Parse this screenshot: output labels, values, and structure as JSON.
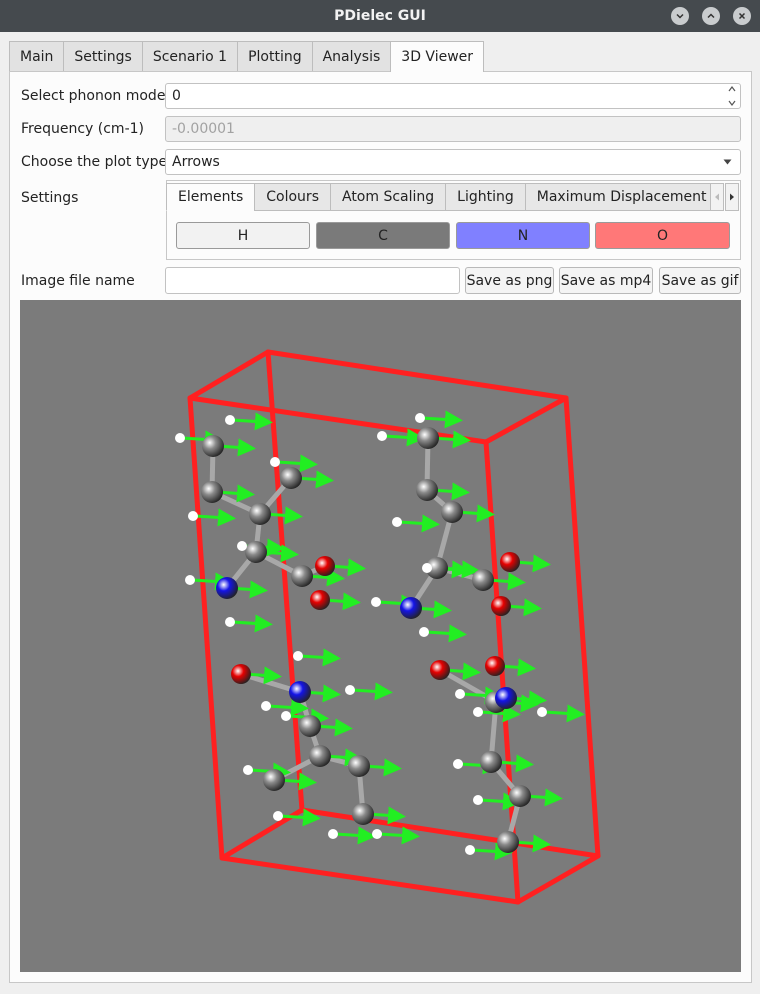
{
  "window": {
    "title": "PDielec GUI"
  },
  "main_tabs": [
    "Main",
    "Settings",
    "Scenario 1",
    "Plotting",
    "Analysis",
    "3D Viewer"
  ],
  "form": {
    "phonon_mode_label": "Select phonon mode",
    "phonon_mode_value": "0",
    "frequency_label": "Frequency (cm-1)",
    "frequency_value": "-0.00001",
    "plot_type_label": "Choose the plot type",
    "plot_type_value": "Arrows",
    "settings_label": "Settings",
    "image_file_label": "Image file name",
    "image_file_value": ""
  },
  "settings_tabs": [
    "Elements",
    "Colours",
    "Atom Scaling",
    "Lighting",
    "Maximum Displacement"
  ],
  "elements": [
    {
      "label": "H",
      "color": "#f2f2f2"
    },
    {
      "label": "C",
      "color": "#7a7a7a"
    },
    {
      "label": "N",
      "color": "#8080ff"
    },
    {
      "label": "O",
      "color": "#ff7878"
    }
  ],
  "buttons": {
    "save_png": "Save as png",
    "save_mp4": "Save as mp4",
    "save_gif": "Save as gif"
  },
  "viewer": {
    "background": "#7b7b7b",
    "cell_color": "#ff2020",
    "arrow_color": "#22ee22",
    "atom_colors": {
      "H": "#ffffff",
      "C": "#8a8a8a",
      "N": "#1414e6",
      "O": "#e60000"
    }
  }
}
